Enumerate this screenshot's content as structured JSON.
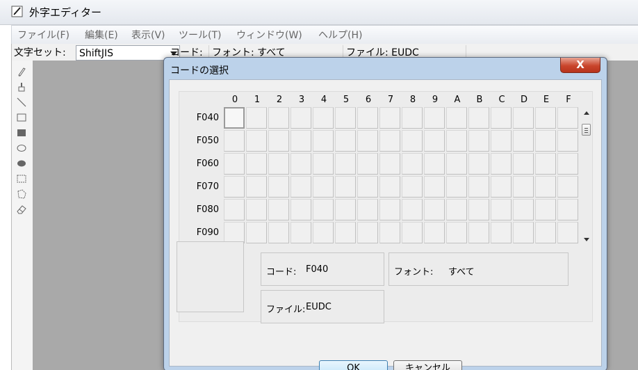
{
  "window": {
    "title": "外字エディター"
  },
  "menu": [
    "ファイル(F)",
    "編集(E)",
    "表示(V)",
    "ツール(T)",
    "ウィンドウ(W)",
    "ヘルプ(H)"
  ],
  "toolbar": {
    "charset_label": "文字セット:",
    "charset_value": "ShiftJIS",
    "code_label": "コード:",
    "font_label": "フォント: すべて",
    "file_label": "ファイル: EUDC"
  },
  "tools": [
    "pencil-icon",
    "brush-icon",
    "line-icon",
    "hollow-rectangle-icon",
    "filled-rectangle-icon",
    "hollow-ellipse-icon",
    "filled-ellipse-icon",
    "rectangular-selection-icon",
    "freeform-selection-icon",
    "eraser-icon"
  ],
  "dialog": {
    "title": "コードの選択",
    "close_symbol": "X",
    "column_headers": [
      "0",
      "1",
      "2",
      "3",
      "4",
      "5",
      "6",
      "7",
      "8",
      "9",
      "A",
      "B",
      "C",
      "D",
      "E",
      "F"
    ],
    "row_headers": [
      "F040",
      "F050",
      "F060",
      "F070",
      "F080",
      "F090"
    ],
    "selected_code": "F040",
    "code_label": "コード:",
    "code_value": "F040",
    "font_label": "フォント:",
    "font_value": "すべて",
    "file_label": "ファイル:",
    "file_value": "EUDC",
    "ok_label": "OK",
    "cancel_label": "キャンセル"
  },
  "colors": {
    "dialog_frame": "#bcd2ea",
    "close_button": "#c9452c",
    "ok_button_border": "#3c7fb1",
    "workspace": "#a9a9a9"
  }
}
